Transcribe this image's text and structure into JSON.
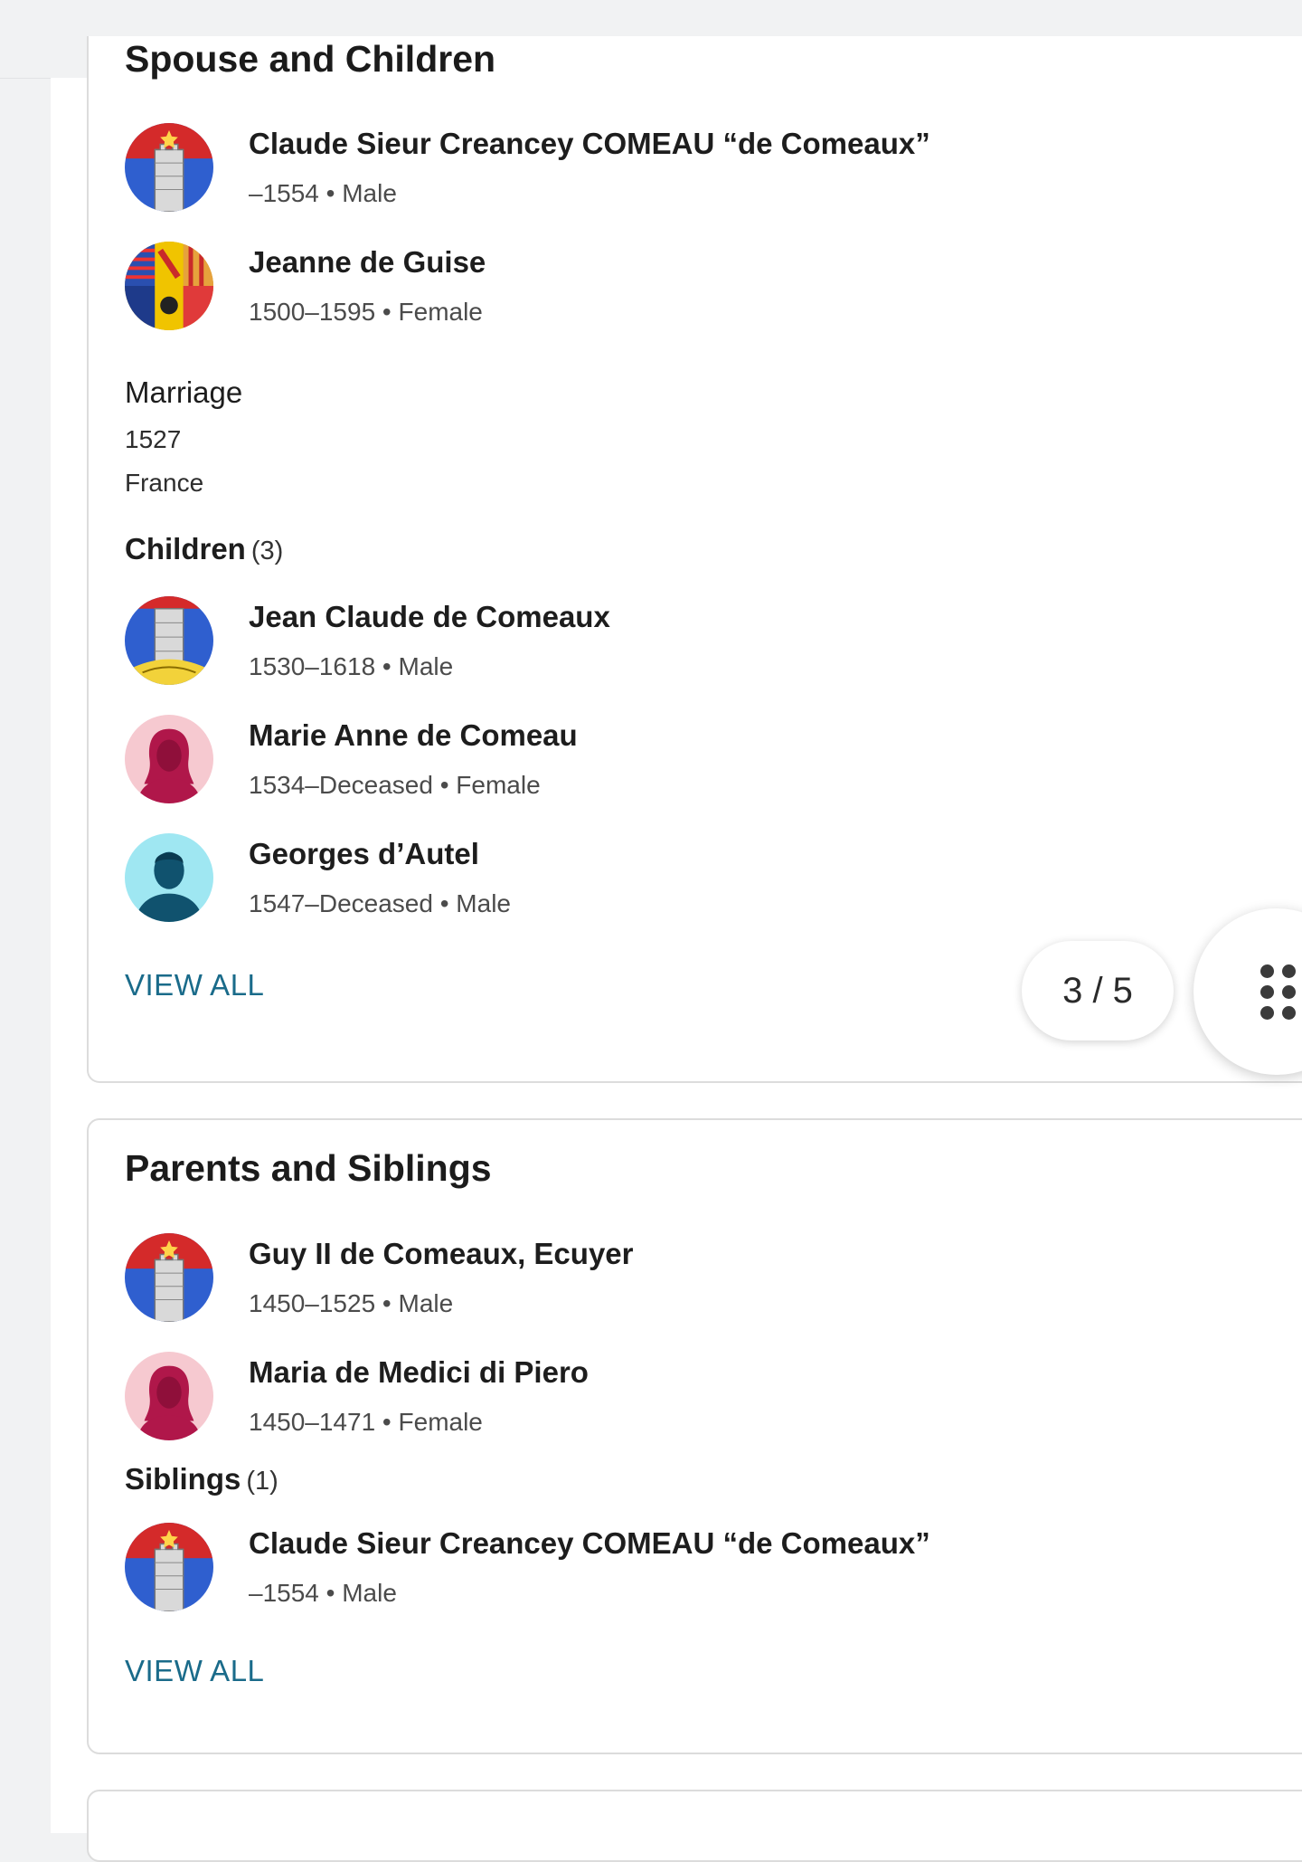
{
  "spouse_section": {
    "title": "Spouse and Children",
    "spouses": [
      {
        "name": "Claude Sieur Creancey COMEAU “de Comeaux”",
        "meta": "–1554 • Male",
        "avatar_icon": "coat-of-arms-tower-icon"
      },
      {
        "name": "Jeanne de Guise",
        "meta": "1500–1595 • Female",
        "avatar_icon": "coat-of-arms-quartered-icon"
      }
    ],
    "marriage": {
      "label": "Marriage",
      "date": "1527",
      "place": "France"
    },
    "children_label": "Children",
    "children_count": "(3)",
    "children": [
      {
        "name": "Jean Claude de Comeaux",
        "meta": "1530–1618 • Male",
        "avatar_icon": "coat-of-arms-tower-gold-icon"
      },
      {
        "name": "Marie Anne de Comeau",
        "meta": "1534–Deceased • Female",
        "avatar_icon": "female-silhouette-icon"
      },
      {
        "name": "Georges d’Autel",
        "meta": "1547–Deceased • Male",
        "avatar_icon": "male-silhouette-icon"
      }
    ],
    "view_all": "VIEW ALL"
  },
  "parents_section": {
    "title": "Parents and Siblings",
    "parents": [
      {
        "name": "Guy II de Comeaux, Ecuyer",
        "meta": "1450–1525 • Male",
        "avatar_icon": "coat-of-arms-tower-icon"
      },
      {
        "name": "Maria de Medici di Piero",
        "meta": "1450–1471 • Female",
        "avatar_icon": "female-silhouette-icon"
      }
    ],
    "siblings_label": "Siblings",
    "siblings_count": "(1)",
    "siblings": [
      {
        "name": "Claude Sieur Creancey COMEAU “de Comeaux”",
        "meta": "–1554 • Male",
        "avatar_icon": "coat-of-arms-tower-icon"
      }
    ],
    "view_all": "VIEW ALL"
  },
  "pager": {
    "text": "3 / 5"
  },
  "fab": {
    "icon": "dots-grid-icon"
  },
  "colors": {
    "link": "#1a6b8a",
    "female_avatar_bg": "#f6c9d0",
    "female_avatar_fg": "#b0174a",
    "male_avatar_bg": "#9fe7f2",
    "male_avatar_fg": "#10526e",
    "shield_blue": "#2f5fcf",
    "shield_red": "#d42a2a"
  }
}
